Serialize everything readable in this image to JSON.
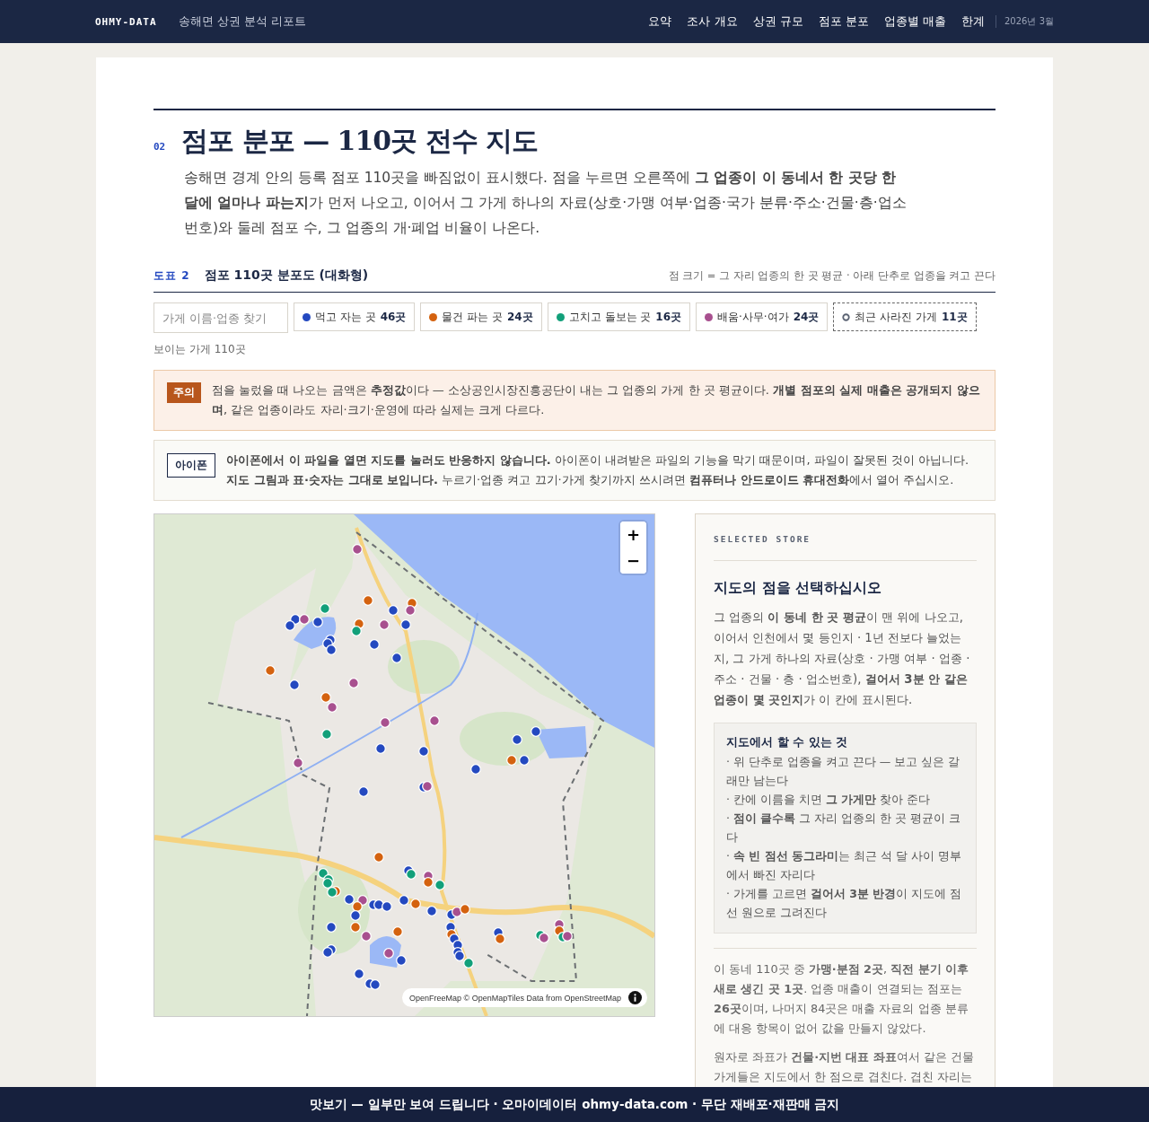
{
  "header": {
    "brand": "OHMY-DATA",
    "subtitle": "송해면 상권 분석 리포트",
    "nav": [
      "요약",
      "조사 개요",
      "상권 규모",
      "점포 분포",
      "업종별 매출",
      "한계"
    ],
    "date": "2026년 3월"
  },
  "section": {
    "number": "02",
    "title": "점포 분포 — 110곳 전수 지도",
    "lead": "송해면 경계 안의 등록 점포 110곳을 빠짐없이 표시했다. 점을 누르면 오른쪽에 **그 업종이 이 동네서 한 곳당 한 달에 얼마나 파는지**가 먼저 나오고, 이어서 그 가게 하나의 자료(상호·가맹 여부·업종·국가 분류·주소·건물·층·업소번호)와 둘레 점포 수, 그 업종의 개·폐업 비율이 나온다."
  },
  "figure": {
    "label": "도표 2",
    "title": "점포 110곳 분포도 (대화형)",
    "note": "점 크기 = 그 자리 업종의 한 곳 평균 · 아래 단추로 업종을 켜고 끈다"
  },
  "search": {
    "placeholder": "가게 이름·업종 찾기"
  },
  "filters": [
    {
      "kind": "dot",
      "label": "먹고 자는 곳",
      "count": "46곳",
      "color": "#2449c0",
      "on": true
    },
    {
      "kind": "dot",
      "label": "물건 파는 곳",
      "count": "24곳",
      "color": "#d4620f",
      "on": true
    },
    {
      "kind": "dot",
      "label": "고치고 돌보는 곳",
      "count": "16곳",
      "color": "#12a07a",
      "on": true
    },
    {
      "kind": "dot",
      "label": "배움·사무·여가",
      "count": "24곳",
      "color": "#a8508f",
      "on": true
    },
    {
      "kind": "ring",
      "label": "최근 사라진 가게",
      "count": "11곳",
      "color": "#5a6272",
      "on": true
    }
  ],
  "visible_count": "보이는 가게 110곳",
  "callouts": [
    {
      "kind": "warning",
      "badge": "주의",
      "text": "점을 눌렀을 때 나오는 금액은 **추정값**이다 — 소상공인시장진흥공단이 내는 그 업종의 가게 한 곳 평균이다. **개별 점포의 실제 매출은 공개되지 않으며**, 같은 업종이라도 자리·크기·운영에 따라 실제는 크게 다르다."
    },
    {
      "kind": "note",
      "badge": "아이폰",
      "text": "**아이폰에서 이 파일을 열면 지도를 눌러도 반응하지 않습니다.** 아이폰이 내려받은 파일의 기능을 막기 때문이며, 파일이 잘못된 것이 아닙니다. **지도 그림과 표·숫자는 그대로 보입니다.** 누르기·업종 켜고 끄기·가게 찾기까지 쓰시려면 **컴퓨터나 안드로이드 휴대전화**에서 열어 주십시오."
    }
  ],
  "map": {
    "kind": "picture",
    "zoom_in": "+",
    "zoom_out": "−",
    "attribution": "OpenFreeMap © OpenMapTiles Data from OpenStreetMap"
  },
  "panel": {
    "eyebrow": "SELECTED STORE",
    "heading": "지도의 점을 선택하십시오",
    "intro": "그 업종의 **이 동네 한 곳 평균**이 맨 위에 나오고, 이어서 인천에서 몇 등인지 · 1년 전보다 늘었는지, 그 가게 하나의 자료(상호 · 가맹 여부 · 업종 · 주소 · 건물 · 층 · 업소번호), **걸어서 3분 안 같은 업종이 몇 곳인지**가 이 칸에 표시된다.",
    "tips_title": "지도에서 할 수 있는 것",
    "tips": [
      "· 위 단추로 업종을 켜고 끈다 — 보고 싶은 갈래만 남는다",
      "· 칸에 이름을 치면 **그 가게만** 찾아 준다",
      "· **점이 클수록** 그 자리 업종의 한 곳 평균이 크다",
      "· **속 빈 점선 동그라미**는 최근 석 달 사이 명부에서 빠진 자리다",
      "· 가게를 고르면 **걸어서 3분 반경**이 지도에 점선 원으로 그려진다"
    ],
    "notes": [
      "이 동네 110곳 중 **가맹·분점 2곳**, **직전 분기 이후 새로 생긴 곳 1곳**. 업종 매출이 연결되는 점포는 **26곳**이며, 나머지 84곳은 매출 자료의 업종 분류에 대응 항목이 없어 값을 만들지 않았다.",
      "원자로 좌표가 **건물·지번 대표 좌표**여서 같은 건물 가게들은 지도에서 한 점으로 겹친다. 겹친 자리는"
    ]
  },
  "footer": "맛보기 — 일부만 보여 드립니다 · 오마이데이터 ohmy-data.com · 무단 재배포·재판매 금지"
}
